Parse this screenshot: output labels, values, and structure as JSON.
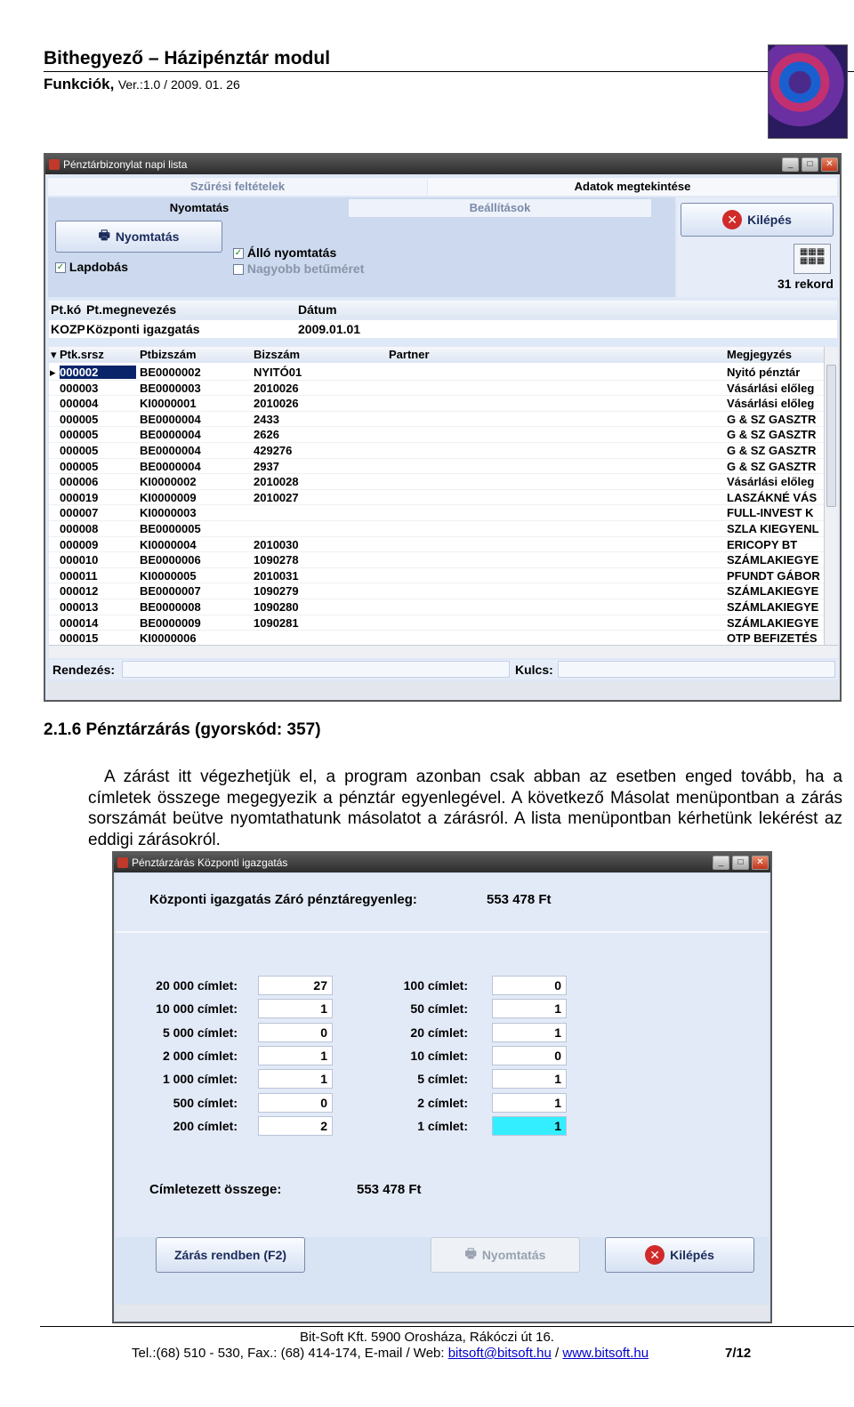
{
  "header": {
    "title": "Bithegyező – Házipénztár modul",
    "functions": "Funkciók,",
    "version": "Ver.:1.0 / 2009. 01. 26"
  },
  "window1": {
    "title": "Pénztárbizonylat napi lista",
    "tab_filter": "Szűrési feltételek",
    "tab_data": "Adatok megtekintése",
    "tab_print": "Nyomtatás",
    "tab_settings": "Beállítások",
    "print_button": "Nyomtatás",
    "exit_button": "Kilépés",
    "chk_lapdobas": "Lapdobás",
    "chk_allo": "Álló nyomtatás",
    "chk_nagyobb": "Nagyobb betűméret",
    "record_count": "31 rekord",
    "filter_headers": {
      "ptko": "Pt.kó",
      "ptmegn": "Pt.megnevezés",
      "datum": "Dátum"
    },
    "filter_values": {
      "ptko": "KOZP",
      "ptmegn": "Központi igazgatás",
      "datum": "2009.01.01"
    },
    "columns": [
      "Ptk.srsz",
      "Ptbizszám",
      "Bizszám",
      "Partner",
      "Megjegyzés"
    ],
    "rows": [
      [
        "000002",
        "BE0000002",
        "NYITÓ01",
        "",
        "Nyitó pénztár"
      ],
      [
        "000003",
        "BE0000003",
        "2010026",
        "",
        "Vásárlási előleg"
      ],
      [
        "000004",
        "KI0000001",
        "2010026",
        "",
        "Vásárlási előleg"
      ],
      [
        "000005",
        "BE0000004",
        "2433",
        "",
        "G & SZ GASZTR"
      ],
      [
        "000005",
        "BE0000004",
        "2626",
        "",
        "G & SZ GASZTR"
      ],
      [
        "000005",
        "BE0000004",
        "429276",
        "",
        "G & SZ GASZTR"
      ],
      [
        "000005",
        "BE0000004",
        "2937",
        "",
        "G & SZ GASZTR"
      ],
      [
        "000006",
        "KI0000002",
        "2010028",
        "",
        "Vásárlási előleg"
      ],
      [
        "000019",
        "KI0000009",
        "2010027",
        "",
        "LASZÁKNÉ VÁS"
      ],
      [
        "000007",
        "KI0000003",
        "",
        "",
        "FULL-INVEST K"
      ],
      [
        "000008",
        "BE0000005",
        "",
        "",
        "SZLA KIEGYENL"
      ],
      [
        "000009",
        "KI0000004",
        "2010030",
        "",
        "ERICOPY BT"
      ],
      [
        "000010",
        "BE0000006",
        "1090278",
        "",
        "SZÁMLAKIEGYE"
      ],
      [
        "000011",
        "KI0000005",
        "2010031",
        "",
        "PFUNDT GÁBOR"
      ],
      [
        "000012",
        "BE0000007",
        "1090279",
        "",
        "SZÁMLAKIEGYE"
      ],
      [
        "000013",
        "BE0000008",
        "1090280",
        "",
        "SZÁMLAKIEGYE"
      ],
      [
        "000014",
        "BE0000009",
        "1090281",
        "",
        "SZÁMLAKIEGYE"
      ],
      [
        "000015",
        "KI0000006",
        "",
        "",
        "OTP BEFIZETÉS"
      ]
    ],
    "sort_label": "Rendezés:",
    "key_label": "Kulcs:"
  },
  "section": {
    "heading": "2.1.6 Pénztárzárás (gyorskód: 357)",
    "paragraph": "A zárást itt végezhetjük el, a program azonban csak abban az esetben enged tovább, ha a címletek összege megegyezik a pénztár egyenlegével. A következő Másolat menüpontban a zárás sorszámát beütve nyomtathatunk másolatot a zárásról. A lista menüpontban kérhetünk lekérést az eddigi zárásokról."
  },
  "window2": {
    "title": "Pénztárzárás Központi igazgatás",
    "balance_label": "Központi igazgatás Záró pénztáregyenleg:",
    "balance_value": "553 478 Ft",
    "left_denoms": [
      {
        "label": "20 000 címlet:",
        "value": "27"
      },
      {
        "label": "10 000 címlet:",
        "value": "1"
      },
      {
        "label": "5 000 címlet:",
        "value": "0"
      },
      {
        "label": "2 000 címlet:",
        "value": "1"
      },
      {
        "label": "1 000 címlet:",
        "value": "1"
      },
      {
        "label": "500 címlet:",
        "value": "0"
      },
      {
        "label": "200 címlet:",
        "value": "2"
      }
    ],
    "right_denoms": [
      {
        "label": "100 címlet:",
        "value": "0"
      },
      {
        "label": "50 címlet:",
        "value": "1"
      },
      {
        "label": "20 címlet:",
        "value": "1"
      },
      {
        "label": "10 címlet:",
        "value": "0"
      },
      {
        "label": "5 címlet:",
        "value": "1"
      },
      {
        "label": "2 címlet:",
        "value": "1"
      },
      {
        "label": "1 címlet:",
        "value": "1"
      }
    ],
    "total_label": "Címletezett összege:",
    "total_value": "553 478 Ft",
    "close_button": "Zárás rendben (F2)",
    "print_button": "Nyomtatás",
    "exit_button": "Kilépés"
  },
  "footer": {
    "company": "Bit-Soft Kft. 5900 Orosháza, Rákóczi út 16.",
    "contact_prefix": "Tel.:(68) 510 - 530, Fax.: (68) 414-174, E-mail / Web: ",
    "email": "bitsoft@bitsoft.hu",
    "separator": " / ",
    "web": "www.bitsoft.hu",
    "page": "7/12"
  },
  "colors": {
    "window_bg": "#dfe8f6",
    "highlight_field": "#33eeff",
    "selected_row": "#0a246a"
  }
}
